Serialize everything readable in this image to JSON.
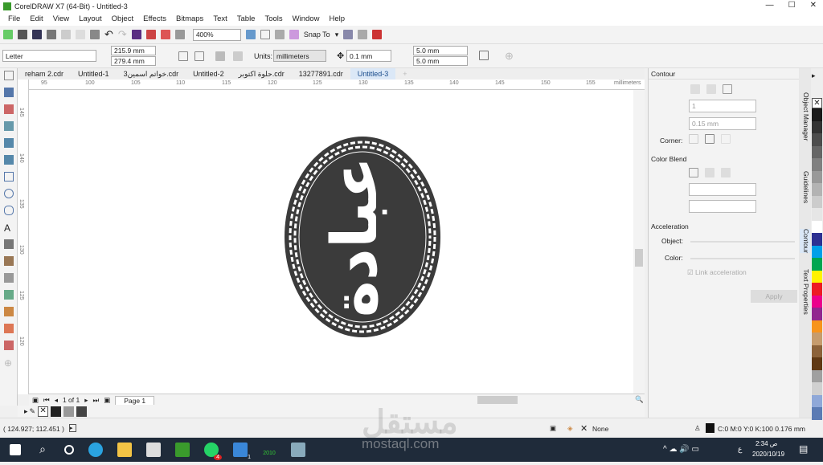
{
  "window": {
    "title": "CorelDRAW X7 (64-Bit) - Untitled-3",
    "min": "—",
    "max": "☐",
    "close": "✕"
  },
  "menu": [
    "File",
    "Edit",
    "View",
    "Layout",
    "Object",
    "Effects",
    "Bitmaps",
    "Text",
    "Table",
    "Tools",
    "Window",
    "Help"
  ],
  "toolbar": {
    "zoom": "400%",
    "snap_to": "Snap To"
  },
  "property_bar": {
    "page_size": "Letter",
    "width": "215.9 mm",
    "height": "279.4 mm",
    "units_label": "Units:",
    "units": "millimeters",
    "nudge": "0.1 mm",
    "dup_x": "5.0 mm",
    "dup_y": "5.0 mm"
  },
  "tabs": [
    {
      "label": "reham 2.cdr"
    },
    {
      "label": "Untitled-1"
    },
    {
      "label": "خواتم اسمين3.cdr"
    },
    {
      "label": "Untitled-2"
    },
    {
      "label": "حلوة اكتوبر.cdr"
    },
    {
      "label": "13277891.cdr"
    },
    {
      "label": "Untitled-3",
      "active": true
    }
  ],
  "ruler": {
    "h": [
      "95",
      "100",
      "105",
      "110",
      "115",
      "120",
      "125",
      "130",
      "135",
      "140",
      "145",
      "150",
      "155"
    ],
    "unit": "millimeters",
    "v": [
      "145",
      "140",
      "135",
      "130",
      "125",
      "120"
    ]
  },
  "artwork": {
    "text": "عبادة",
    "fill": "#3b3b3b"
  },
  "page_nav": {
    "count": "1 of 1",
    "page": "Page 1"
  },
  "status": {
    "coords": "( 124.927; 112.451 )",
    "fill": "None",
    "outline": "C:0 M:0 Y:0 K:100  0.176 mm"
  },
  "docker": {
    "title": "Contour",
    "steps": "1",
    "offset": "0.15 mm",
    "corner": "Corner:",
    "color_blend": "Color Blend",
    "acceleration": "Acceleration",
    "object": "Object:",
    "color": "Color:",
    "link": "Link acceleration",
    "apply": "Apply"
  },
  "side_tabs": [
    "Object Manager",
    "Guidelines",
    "Contour",
    "Text Properties"
  ],
  "palette": [
    "#1a1a1a",
    "#333",
    "#4d4d4d",
    "#666",
    "#808080",
    "#999",
    "#b3b3b3",
    "#ccc",
    "#e6e6e6",
    "#fff",
    "#2e3192",
    "#00a0e9",
    "#00a651",
    "#fff200",
    "#ed1c24",
    "#ec008c",
    "#92278f",
    "#f7941d",
    "#c69c6d",
    "#8c6239",
    "#603813",
    "#a0a0a0",
    "#d0d0d0",
    "#8fa8d8",
    "#5b7bb4"
  ],
  "taskbar": {
    "time": "2:34 ص",
    "date": "2020/10/19",
    "lang": "ع",
    "whatsapp_badge": "4",
    "mail_badge": "1",
    "app_label": "2010"
  },
  "watermark": {
    "arabic": "مستقل",
    "latin": "mostaql.com"
  }
}
